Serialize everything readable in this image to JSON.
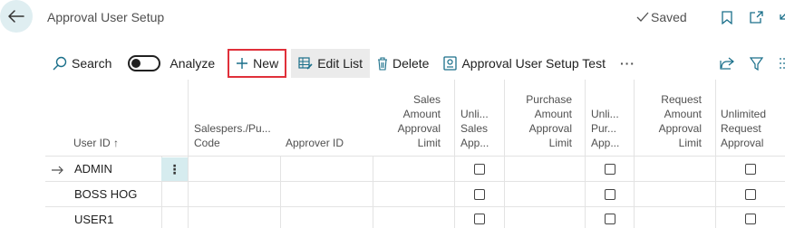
{
  "header": {
    "title": "Approval User Setup",
    "saved_label": "Saved"
  },
  "toolbar": {
    "search_label": "Search",
    "analyze_label": "Analyze",
    "analyze_on": false,
    "new_label": "New",
    "edit_list_label": "Edit List",
    "delete_label": "Delete",
    "test_label": "Approval User Setup Test",
    "more_label": "···"
  },
  "columns": {
    "user_id": "User ID ↑",
    "salespers_line1": "Salespers./Pu...",
    "salespers_line2": "Code",
    "approver_id": "Approver ID",
    "sales_amount": [
      "Sales",
      "Amount",
      "Approval",
      "Limit"
    ],
    "unlim_sales": [
      "Unli...",
      "Sales",
      "App..."
    ],
    "purchase_amount": [
      "Purchase",
      "Amount",
      "Approval",
      "Limit"
    ],
    "unlim_purch": [
      "Unli...",
      "Pur...",
      "App..."
    ],
    "request_amount": [
      "Request",
      "Amount",
      "Approval",
      "Limit"
    ],
    "unlim_request": [
      "Unlimited",
      "Request",
      "Approval"
    ]
  },
  "rows": [
    {
      "user_id": "ADMIN",
      "selected": true
    },
    {
      "user_id": "BOSS HOG",
      "selected": false
    },
    {
      "user_id": "USER1",
      "selected": false
    }
  ],
  "colors": {
    "accent_teal": "#dfeef1",
    "highlight_red": "#e0303a",
    "selected_cell": "#d6ecef"
  },
  "icons": {
    "back": "arrow-left-icon",
    "saved": "checkmark-icon",
    "bookmark": "bookmark-icon",
    "open_new": "open-in-new-window-icon",
    "collapse": "collapse-icon",
    "search": "search-icon",
    "new": "plus-icon",
    "edit_list": "edit-list-icon",
    "delete": "trash-icon",
    "test": "report-icon",
    "share": "share-icon",
    "filter": "filter-icon",
    "columns": "list-options-icon",
    "row_marker": "arrow-right-icon",
    "row_actions": "vertical-ellipsis-icon"
  }
}
